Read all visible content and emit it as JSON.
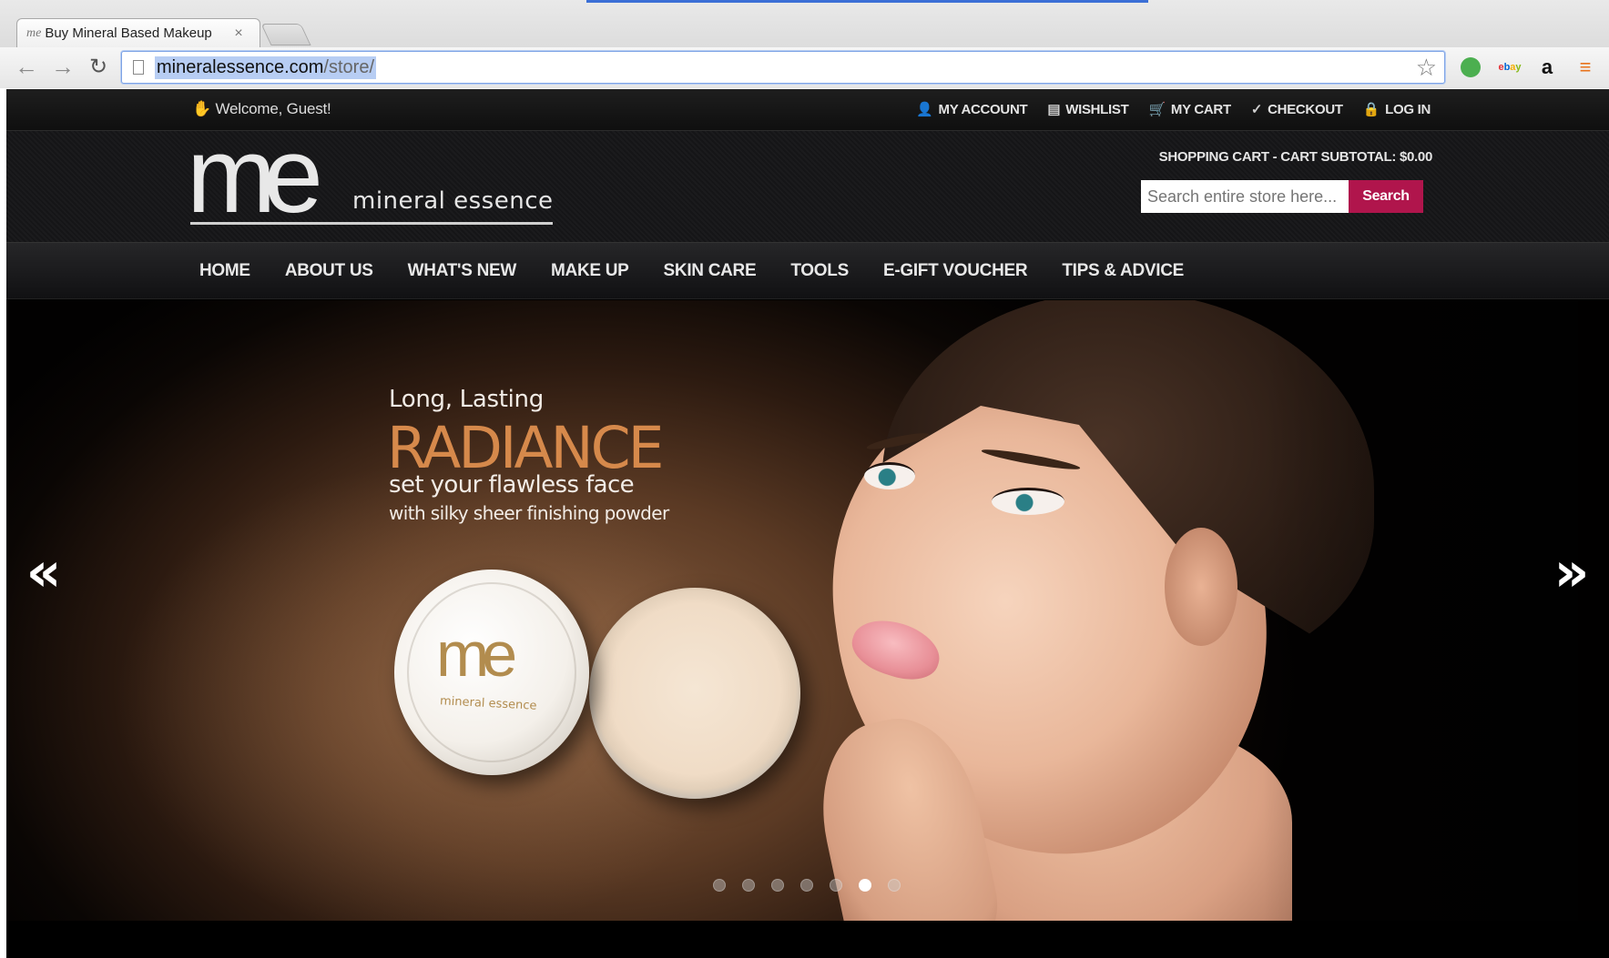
{
  "browser": {
    "tab_title": "Buy Mineral Based Makeup",
    "tab_favicon": "me",
    "tab_close": "×",
    "url_host": "mineralessence.com",
    "url_path": "/store/",
    "icons": [
      "back-icon",
      "forward-icon",
      "reload-icon",
      "page-icon",
      "star-icon",
      "evernote-icon",
      "ebay-icon",
      "amazon-icon",
      "menu-icon"
    ]
  },
  "topbar": {
    "welcome": "Welcome, Guest!",
    "links": [
      {
        "label": "MY ACCOUNT",
        "icon": "user-icon"
      },
      {
        "label": "WISHLIST",
        "icon": "document-icon"
      },
      {
        "label": "MY CART",
        "icon": "cart-icon"
      },
      {
        "label": "CHECKOUT",
        "icon": "check-icon"
      },
      {
        "label": "LOG IN",
        "icon": "lock-icon"
      }
    ]
  },
  "header": {
    "logo_mark": "me",
    "logo_name": "mineral essence",
    "cart_summary": "SHOPPING CART - CART SUBTOTAL: $0.00",
    "search_placeholder": "Search entire store here...",
    "search_button": "Search",
    "search_button_color": "#b0154c"
  },
  "nav": {
    "items": [
      "HOME",
      "ABOUT US",
      "WHAT'S NEW",
      "MAKE UP",
      "SKIN CARE",
      "TOOLS",
      "E-GIFT VOUCHER",
      "TIPS & ADVICE"
    ]
  },
  "hero": {
    "line1": "Long, Lasting",
    "line2": "RADIANCE",
    "line3": "set your flawless face",
    "line4": "with silky sheer finishing powder",
    "jar_logo": "me",
    "jar_logo_sub": "mineral essence",
    "accent_color": "#d6894b",
    "prev_arrow": "«",
    "next_arrow": "»",
    "slide_count": 7,
    "active_slide": 6
  }
}
